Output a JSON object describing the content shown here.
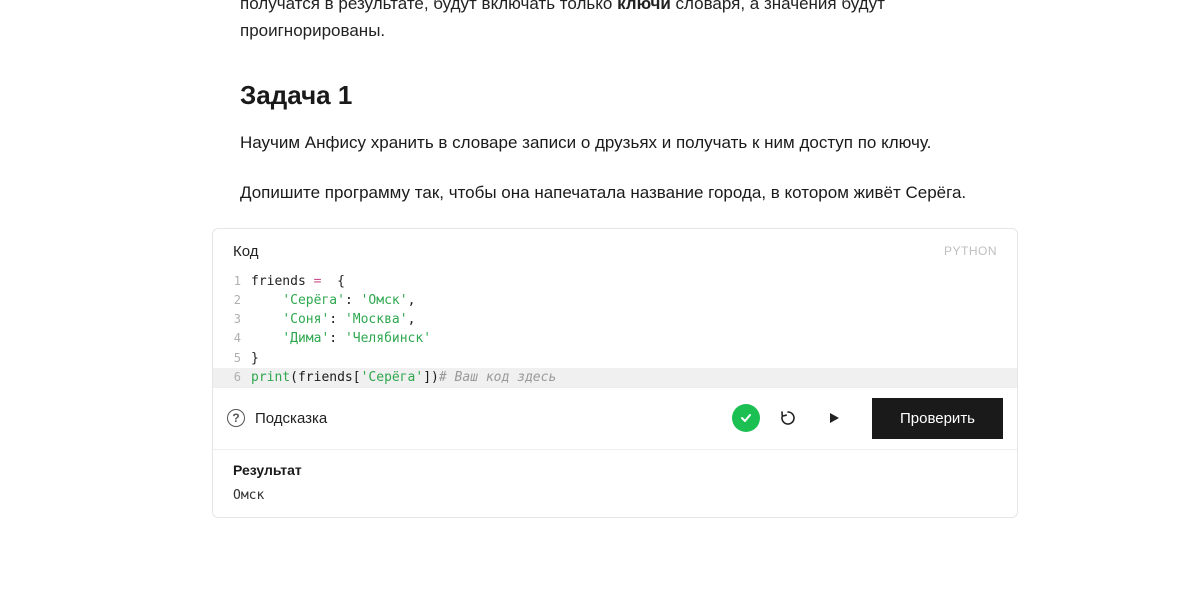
{
  "intro": {
    "pre": "получатся в результате, будут включать только ",
    "bold": "ключи",
    "post": " словаря, а значения будут проигнорированы."
  },
  "task": {
    "title": "Задача 1",
    "p1": "Научим Анфису хранить в словаре записи о друзьях и получать к ним доступ по ключу.",
    "p2": "Допишите программу так, чтобы она напечатала название города, в котором живёт Серёга."
  },
  "editor": {
    "label": "Код",
    "language": "PYTHON",
    "lines": {
      "l1": {
        "n": "1",
        "a": "friends",
        "b": " =  ",
        "c": "{"
      },
      "l2": {
        "n": "2",
        "indent": "    ",
        "k": "'Серёга'",
        "sep": ": ",
        "v": "'Омск'",
        "comma": ","
      },
      "l3": {
        "n": "3",
        "indent": "    ",
        "k": "'Соня'",
        "sep": ": ",
        "v": "'Москва'",
        "comma": ","
      },
      "l4": {
        "n": "4",
        "indent": "    ",
        "k": "'Дима'",
        "sep": ": ",
        "v": "'Челябинск'"
      },
      "l5": {
        "n": "5",
        "a": "}"
      },
      "l6": {
        "n": "6",
        "fn": "print",
        "open": "(friends[",
        "key": "'Серёга'",
        "close": "])",
        "comment": "# Ваш код здесь"
      }
    }
  },
  "controls": {
    "hint_label": "Подсказка",
    "check_label": "Проверить"
  },
  "result": {
    "label": "Результат",
    "output": "Омск"
  },
  "icons": {
    "hint": "?",
    "success": "check-icon",
    "reload": "reload-icon",
    "play": "play-icon"
  }
}
